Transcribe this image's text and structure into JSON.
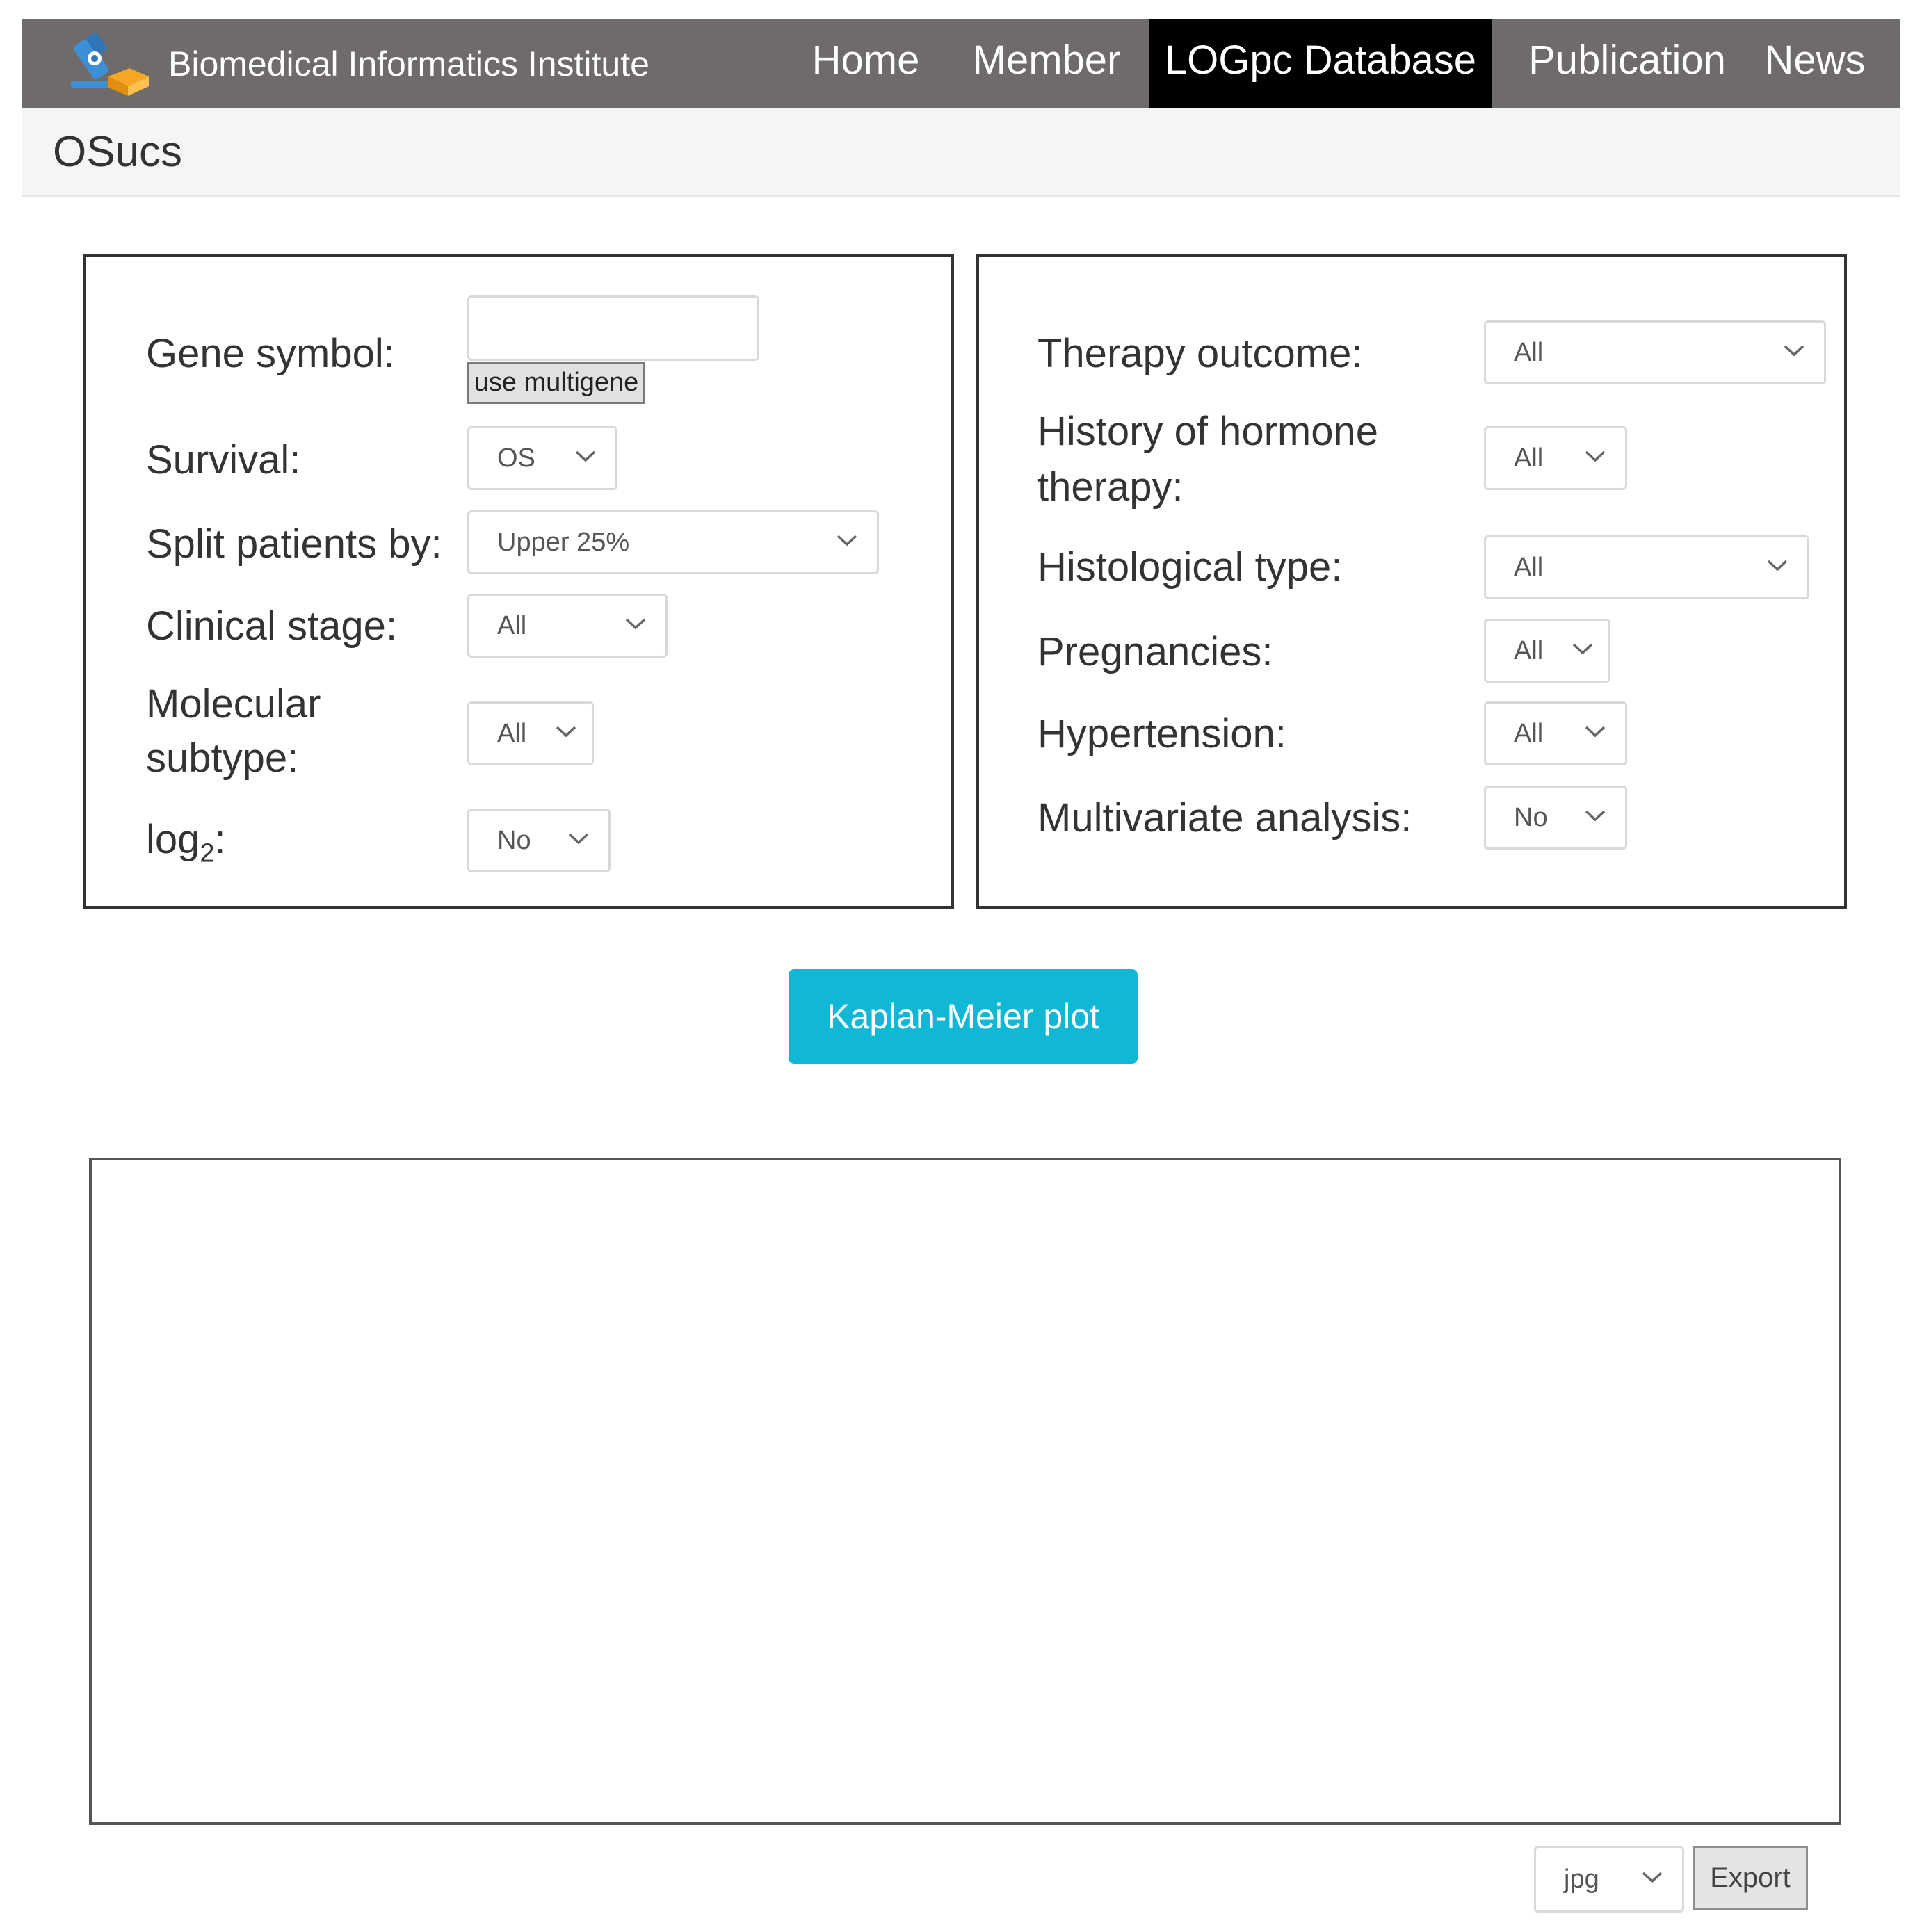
{
  "navbar": {
    "brand": "Biomedical Informatics Institute",
    "items": [
      {
        "label": "Home",
        "active": false
      },
      {
        "label": "Member",
        "active": false
      },
      {
        "label": "LOGpc Database",
        "active": true
      },
      {
        "label": "Publication",
        "active": false
      },
      {
        "label": "News",
        "active": false
      }
    ]
  },
  "page": {
    "title": "OSucs"
  },
  "left_panel": {
    "gene_symbol": {
      "label": "Gene symbol:",
      "value": "",
      "multigene_label": "use multigene"
    },
    "survival": {
      "label": "Survival:",
      "value": "OS"
    },
    "split": {
      "label": "Split patients by:",
      "value": "Upper 25%"
    },
    "clinical_stage": {
      "label": "Clinical stage:",
      "value": "All"
    },
    "molecular_subtype": {
      "label_line1": "Molecular",
      "label_line2": "subtype:",
      "value": "All"
    },
    "log2": {
      "label_main": "log",
      "label_sub": "2",
      "label_colon": ":",
      "value": "No"
    }
  },
  "right_panel": {
    "therapy_outcome": {
      "label": "Therapy outcome:",
      "value": "All"
    },
    "hormone_therapy": {
      "label_line1": "History of hormone",
      "label_line2": "therapy:",
      "value": "All"
    },
    "histological_type": {
      "label": "Histological type:",
      "value": "All"
    },
    "pregnancies": {
      "label": "Pregnancies:",
      "value": "All"
    },
    "hypertension": {
      "label": "Hypertension:",
      "value": "All"
    },
    "multivariate": {
      "label": "Multivariate analysis:",
      "value": "No"
    }
  },
  "actions": {
    "km_label": "Kaplan-Meier plot"
  },
  "export": {
    "format": "jpg",
    "button_label": "Export"
  },
  "colors": {
    "navbar": "#6e6b6a",
    "active_nav": "#000000",
    "accent": "#11b8d6",
    "logo_blue": "#3d8fd6",
    "logo_orange": "#f5a623"
  },
  "icons": {
    "logo": "microscope-book-logo",
    "dropdown": "chevron-down-icon"
  }
}
